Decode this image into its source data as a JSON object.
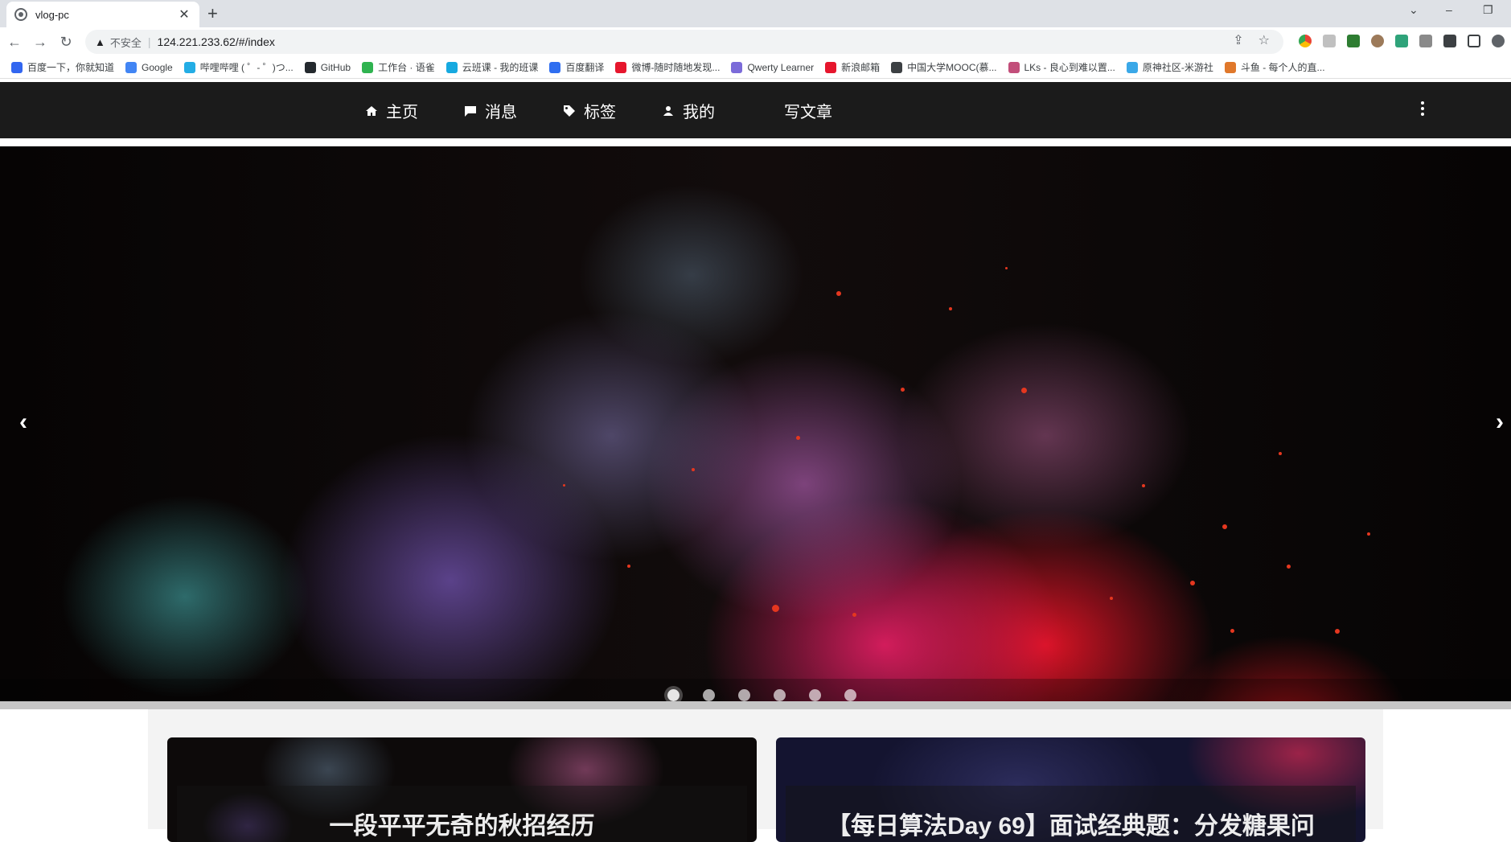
{
  "browser": {
    "tab_title": "vlog-pc",
    "tab_close": "✕",
    "new_tab": "+",
    "window_controls": [
      "⌄",
      "–",
      "❐"
    ],
    "nav": {
      "back": "←",
      "forward": "→",
      "reload": "↻"
    },
    "omnibox": {
      "warning_icon": "▲",
      "security_label": "不安全",
      "separator": "|",
      "url": "124.221.233.62/#/index"
    },
    "bookmarks": [
      {
        "label": "百度一下，你就知道",
        "color": "#3266f0"
      },
      {
        "label": "Google",
        "color": "#4285f4"
      },
      {
        "label": "哔哩哔哩 ( ゜- ゜)つ...",
        "color": "#23ade5"
      },
      {
        "label": "GitHub",
        "color": "#24292e"
      },
      {
        "label": "工作台 · 语雀",
        "color": "#2fb350"
      },
      {
        "label": "云班课 - 我的班课",
        "color": "#16a9e0"
      },
      {
        "label": "百度翻译",
        "color": "#2f6ef0"
      },
      {
        "label": "微博-随时随地发现...",
        "color": "#e6162d"
      },
      {
        "label": "Qwerty Learner",
        "color": "#7b6bd9"
      },
      {
        "label": "新浪邮箱",
        "color": "#e6162d"
      },
      {
        "label": "中国大学MOOC(慕...",
        "color": "#3c4043"
      },
      {
        "label": "LKs - 良心到难以置...",
        "color": "#c24e7a"
      },
      {
        "label": "原神社区-米游社",
        "color": "#3aa8e8"
      },
      {
        "label": "斗鱼 - 每个人的直...",
        "color": "#e0782b"
      }
    ]
  },
  "site": {
    "nav": [
      {
        "label": "主页",
        "icon": "home-icon"
      },
      {
        "label": "消息",
        "icon": "message-icon"
      },
      {
        "label": "标签",
        "icon": "tag-icon"
      },
      {
        "label": "我的",
        "icon": "user-icon"
      },
      {
        "label": "写文章",
        "icon": ""
      }
    ],
    "menu_icon": "more-vertical-icon"
  },
  "carousel": {
    "prev": "‹",
    "next": "›",
    "slide_count": 6,
    "active_index": 0
  },
  "cards": [
    {
      "title": "一段平平无奇的秋招经历"
    },
    {
      "title": "【每日算法Day 69】面试经典题：分发糖果问"
    }
  ],
  "colors": {
    "nav_bg": "#1b1b1b",
    "content_bg": "#f3f3f3"
  }
}
